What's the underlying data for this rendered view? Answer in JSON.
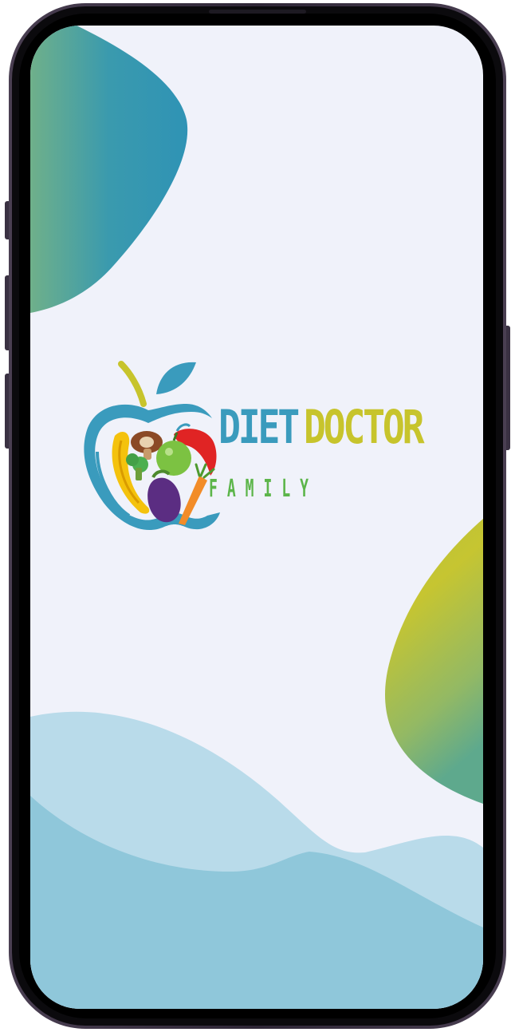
{
  "brand": {
    "line1_word1": "DIET",
    "line1_word2": "DOCTOR",
    "line2": "FAMILY"
  },
  "colors": {
    "screen_background": "#f0f2fa",
    "brand_blue": "#3a9bbd",
    "brand_yellow": "#c7c42c",
    "brand_green": "#5cb54a",
    "wave_light": "#b9dbea",
    "wave_dark": "#8fc7da",
    "phone_frame": "#2b2333"
  },
  "icons": {
    "logo": "apple-fruits-logo-icon"
  }
}
